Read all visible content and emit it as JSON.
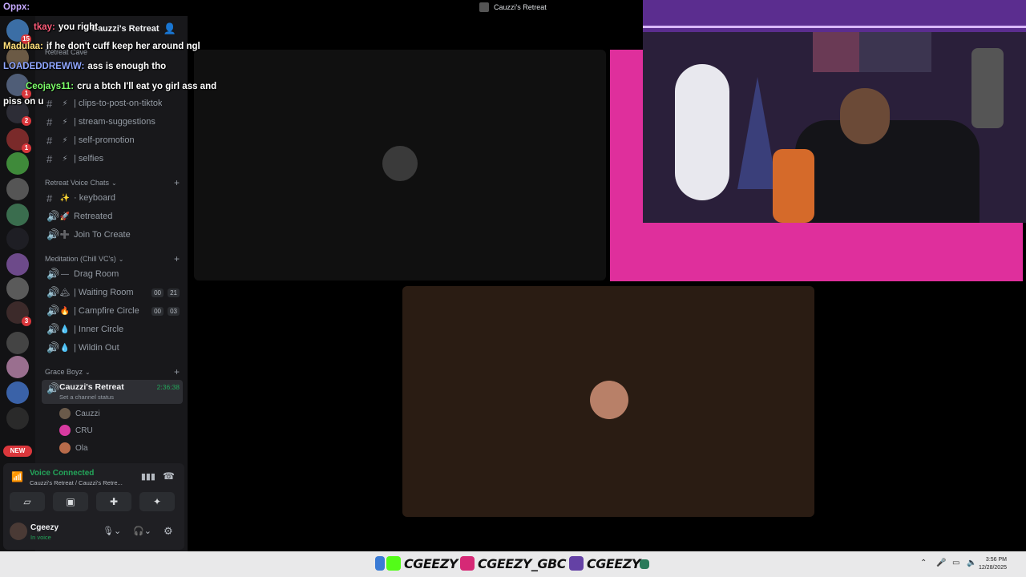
{
  "window": {
    "title": "Cauzzi's Retreat"
  },
  "chat_overlay": [
    {
      "user": "Oppx:",
      "color": "#c6a9ff",
      "text": ""
    },
    {
      "user": "tkay:",
      "color": "#ff5c7a",
      "text": "you right"
    },
    {
      "user": "Madulaa:",
      "color": "#ffe07a",
      "text": "if he don't cuff keep her around ngl"
    },
    {
      "user": "LOADEDDREW\\W:",
      "color": "#8fa6ff",
      "text": "ass is enough tho"
    },
    {
      "user": "Ceojays11:",
      "color": "#7dff6a",
      "text": "cru a btch I'll eat yo girl ass and"
    },
    {
      "user": "",
      "color": "#ffffff",
      "text": "piss on u"
    }
  ],
  "server": {
    "name": "Cauzzi's Retreat",
    "category": "Retreat Cave"
  },
  "text_channels": [
    {
      "emoji": "⚡",
      "name": "| clips-to-post-on-tiktok"
    },
    {
      "emoji": "⚡",
      "name": "| stream-suggestions"
    },
    {
      "emoji": "⚡",
      "name": "| self-promotion"
    },
    {
      "emoji": "⚡",
      "name": "| selfies"
    }
  ],
  "categories": {
    "voice": "Retreat Voice Chats",
    "meditation": "Meditation (Chill VC's)",
    "grace": "Grace Boyz"
  },
  "voice_chats": [
    {
      "type": "text",
      "emoji": "✨",
      "name": "· keyboard"
    },
    {
      "type": "voice",
      "emoji": "🚀",
      "name": "Retreated"
    },
    {
      "type": "voice",
      "emoji": "➕",
      "name": "Join To Create"
    }
  ],
  "meditation_chats": [
    {
      "emoji": "—",
      "name": "Drag Room",
      "a": "",
      "b": ""
    },
    {
      "emoji": "🏔",
      "name": "| Waiting Room",
      "a": "00",
      "b": "21"
    },
    {
      "emoji": "🔥",
      "name": "| Campfire Circle",
      "a": "00",
      "b": "03"
    },
    {
      "emoji": "💧",
      "name": "| Inner Circle",
      "a": "",
      "b": ""
    },
    {
      "emoji": "💧",
      "name": "| Wildin Out",
      "a": "",
      "b": ""
    }
  ],
  "active_channel": {
    "name": "Cauzzi's Retreat",
    "timer": "2:36:38",
    "status": "Set a channel status"
  },
  "voice_users": [
    "Cauzzi",
    "CRU",
    "Ola"
  ],
  "voice_panel": {
    "status": "Voice Connected",
    "location": "Cauzzi's Retreat / Cauzzi's Retre..."
  },
  "user": {
    "name": "Cgeezy",
    "status": "In voice"
  },
  "guild_badges": [
    "15",
    "1",
    "2",
    "1",
    "3"
  ],
  "new_label": "NEW",
  "taskbar": {
    "handles": [
      "CGEEZY",
      "CGEEZY_GBC",
      "CGEEZY"
    ],
    "time": "3:56 PM",
    "date": "12/28/2025"
  },
  "colors": {
    "pink_frame": "#df2f9c",
    "voice_green": "#23a55a",
    "sidebar_bg": "#18181b"
  }
}
